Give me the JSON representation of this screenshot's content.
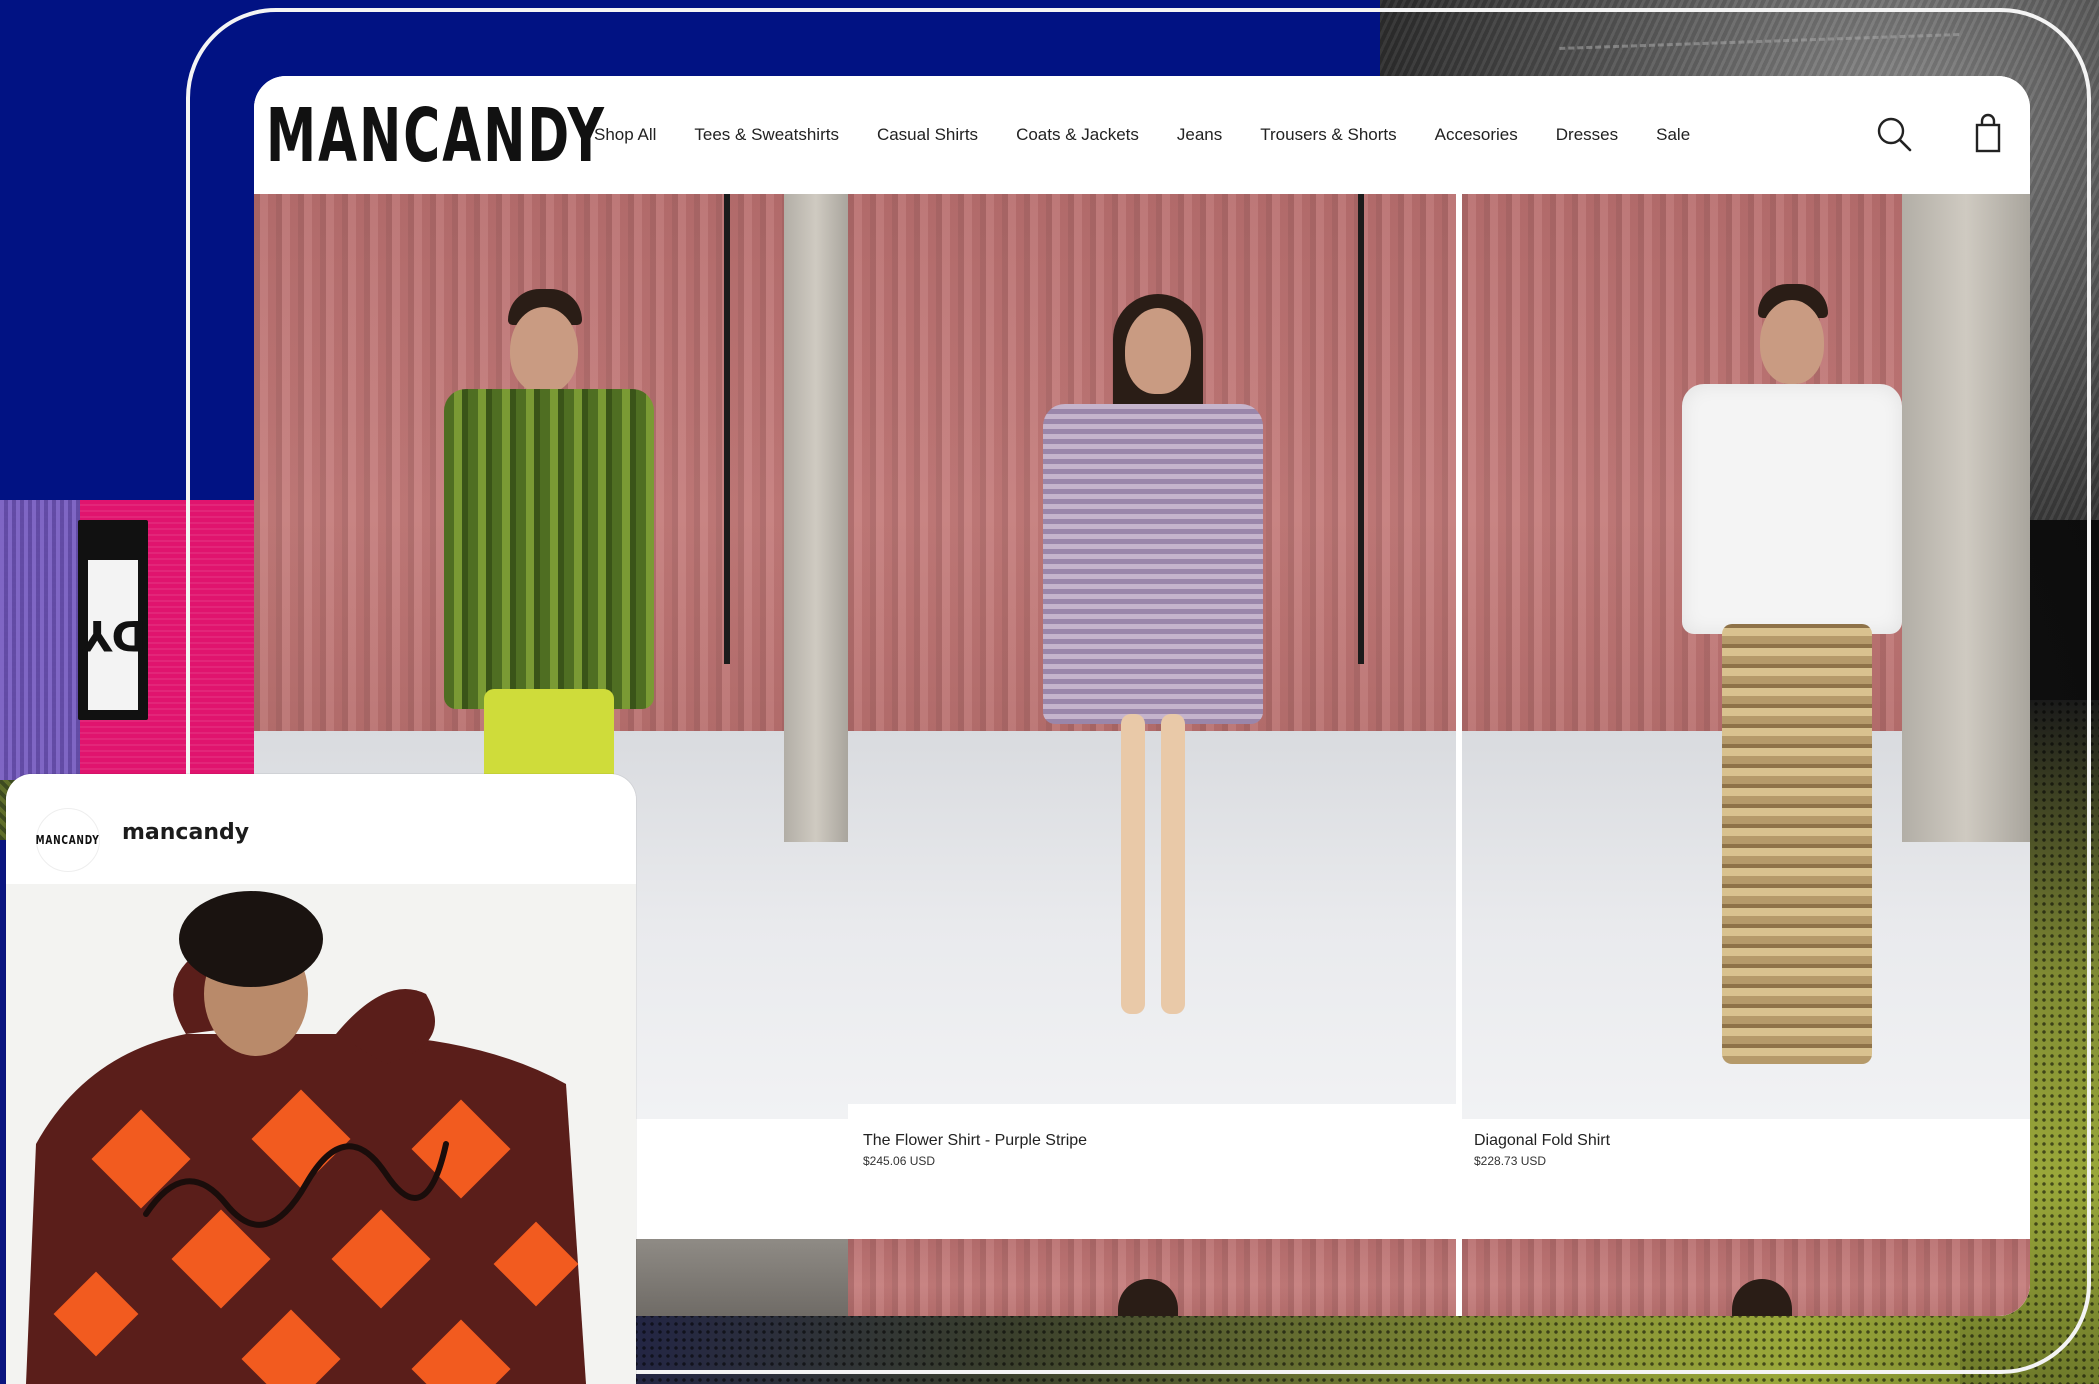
{
  "brand": {
    "logo": "MANCANDY"
  },
  "nav": {
    "items": [
      {
        "label": "Shop All"
      },
      {
        "label": "Tees & Sweatshirts"
      },
      {
        "label": "Casual Shirts"
      },
      {
        "label": "Coats & Jackets"
      },
      {
        "label": "Jeans"
      },
      {
        "label": "Trousers & Shorts"
      },
      {
        "label": "Accesories"
      },
      {
        "label": "Dresses"
      },
      {
        "label": "Sale"
      }
    ]
  },
  "header_icons": {
    "search": "search-icon",
    "cart": "shopping-bag-icon"
  },
  "products": [
    {
      "title": "The Flower Shirt - Purple Stripe",
      "price": "$245.06 USD"
    },
    {
      "title": "Diagonal Fold Shirt",
      "price": "$228.73 USD"
    }
  ],
  "background_label": {
    "text": "DY"
  },
  "instagram": {
    "avatar_text": "MANCANDY",
    "handle": "mancandy"
  },
  "colors": {
    "brand_blue": "#011283",
    "pink": "#e0146e",
    "curtain": "#c47b7a",
    "olive": "#9aa83a"
  }
}
